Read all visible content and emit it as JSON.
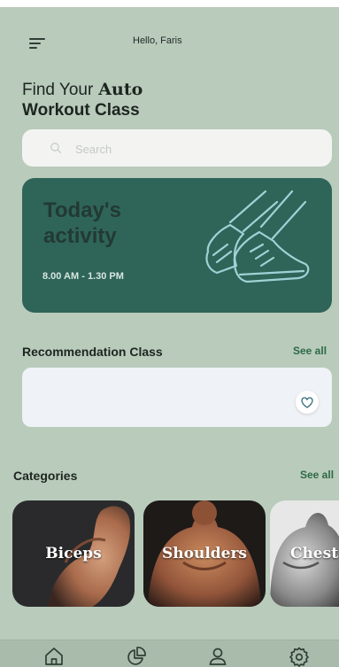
{
  "header": {
    "menu_icon": "hamburger-menu-icon",
    "greeting": "Hello, Faris"
  },
  "hero": {
    "title_prefix": "Find Your",
    "title_highlight": "Auto",
    "title_line2": "Workout Class"
  },
  "search": {
    "placeholder": "Search",
    "value": "",
    "icon": "search-icon"
  },
  "activity": {
    "title": "Today's activity",
    "time": "8.00 AM - 1.30 PM",
    "icon": "running-shoe-icon",
    "colors": {
      "card": "#2f6459",
      "lines": "#9fd2d6"
    }
  },
  "recommendation": {
    "title": "Recommendation Class",
    "see_all": "See all",
    "card_icon": "heart-icon"
  },
  "categories": {
    "title": "Categories",
    "see_all": "See all",
    "items": [
      {
        "label": "Biceps"
      },
      {
        "label": "Shoulders"
      },
      {
        "label": "Chest"
      }
    ]
  },
  "bottom_nav": {
    "items": [
      {
        "icon": "home-icon"
      },
      {
        "icon": "pie-chart-icon"
      },
      {
        "icon": "profile-icon"
      },
      {
        "icon": "settings-icon"
      }
    ]
  },
  "colors": {
    "background": "#b9cbbb",
    "accent": "#2d6b46",
    "card_dark": "#2f6459"
  }
}
